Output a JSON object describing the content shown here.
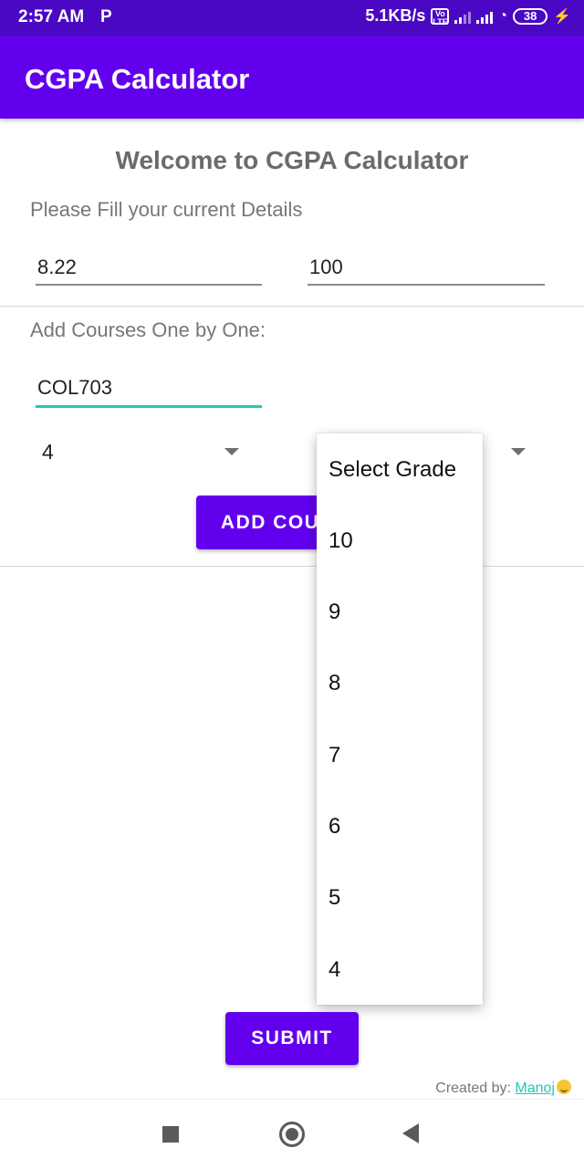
{
  "status_bar": {
    "time": "2:57 AM",
    "p_icon": "P",
    "network_speed": "5.1KB/s",
    "volte": "Vo LTE",
    "battery": "38"
  },
  "app_bar": {
    "title": "CGPA Calculator"
  },
  "main": {
    "welcome": "Welcome to CGPA Calculator",
    "details_prompt": "Please Fill your current Details",
    "current_cgpa": "8.22",
    "current_credits": "100",
    "add_courses_prompt": "Add Courses One by One:",
    "course_code": "COL703",
    "credits_selected": "4",
    "add_course_label": "ADD COURSE",
    "submit_label": "SUBMIT"
  },
  "grade_dropdown": {
    "options": [
      "Select Grade",
      "10",
      "9",
      "8",
      "7",
      "6",
      "5",
      "4"
    ]
  },
  "footer": {
    "created_by": "Created by: ",
    "author": "Manoj"
  },
  "colors": {
    "primary": "#6200ee",
    "status_bar": "#4a08c4",
    "accent": "#1ec8b8"
  }
}
